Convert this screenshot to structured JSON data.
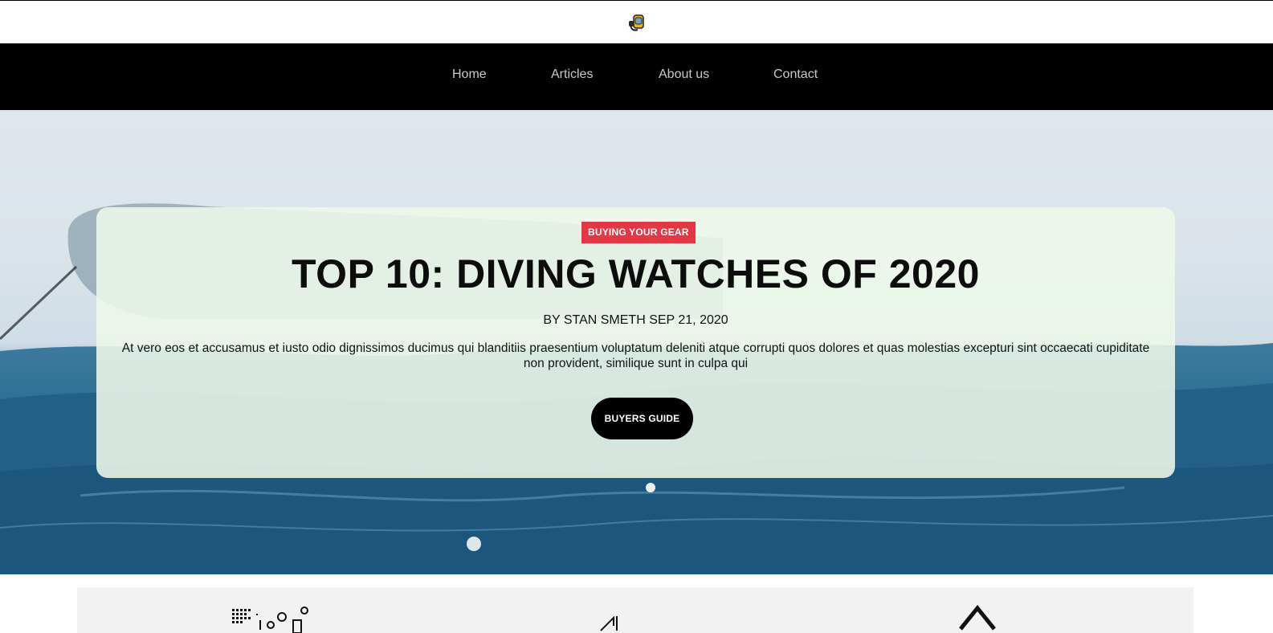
{
  "header": {
    "logo_icon": "snorkel-mask-icon"
  },
  "nav": {
    "items": [
      {
        "label": "Home"
      },
      {
        "label": "Articles"
      },
      {
        "label": "About us"
      },
      {
        "label": "Contact"
      }
    ]
  },
  "hero": {
    "category_tag": "BUYING YOUR GEAR",
    "title": "TOP 10: DIVING WATCHES OF 2020",
    "byline": "BY STAN SMETH SEP 21, 2020",
    "excerpt": "At vero eos et accusamus et iusto odio dignissimos ducimus qui blanditiis praesentium voluptatum deleniti atque corrupti quos dolores et quas molestias excepturi sint occaecati cupiditate non provident, similique sunt in culpa qui",
    "cta_label": "BUYERS GUIDE",
    "background_icon": "ocean-boat-photo"
  },
  "features": {
    "icons": [
      "dot-pattern-icon",
      "fin-icon",
      "mountain-icon"
    ]
  },
  "colors": {
    "nav_background": "#000000",
    "tag_background": "#e23744",
    "card_background": "#eef8eb",
    "cta_background": "#000000"
  }
}
